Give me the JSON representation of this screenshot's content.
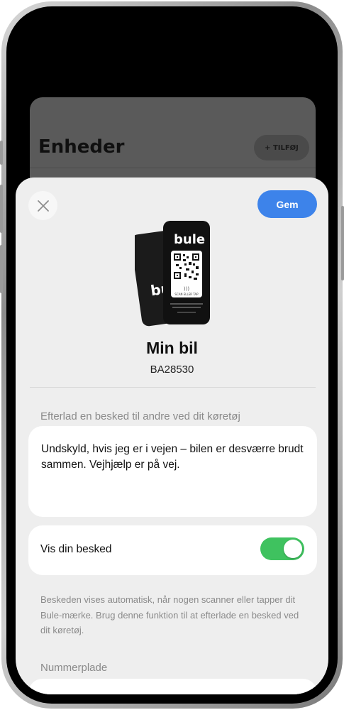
{
  "background_screen": {
    "title": "Enheder",
    "add_button_label": "+ TILFØJ"
  },
  "sheet": {
    "close_icon": "close-icon",
    "save_label": "Gem",
    "device": {
      "name": "Min bil",
      "plate": "BA28530",
      "tag_brand": "bule",
      "tag_caption": "SCAN ELLER TAP"
    },
    "message_section_label": "Efterlad en besked til andre ved dit køretøj",
    "message_text": "Undskyld, hvis jeg er i vejen – bilen er desværre brudt sammen. Vejhjælp er på vej.",
    "show_message_label": "Vis din besked",
    "show_message_enabled": true,
    "help_text": "Beskeden vises automatisk, når nogen scanner eller tapper dit Bule-mærke. Brug denne funktion til at efterlade en besked ved dit køretøj.",
    "plate_section_label": "Nummerplade"
  },
  "colors": {
    "accent": "#3d83ea",
    "toggle_on": "#3fc25f"
  }
}
